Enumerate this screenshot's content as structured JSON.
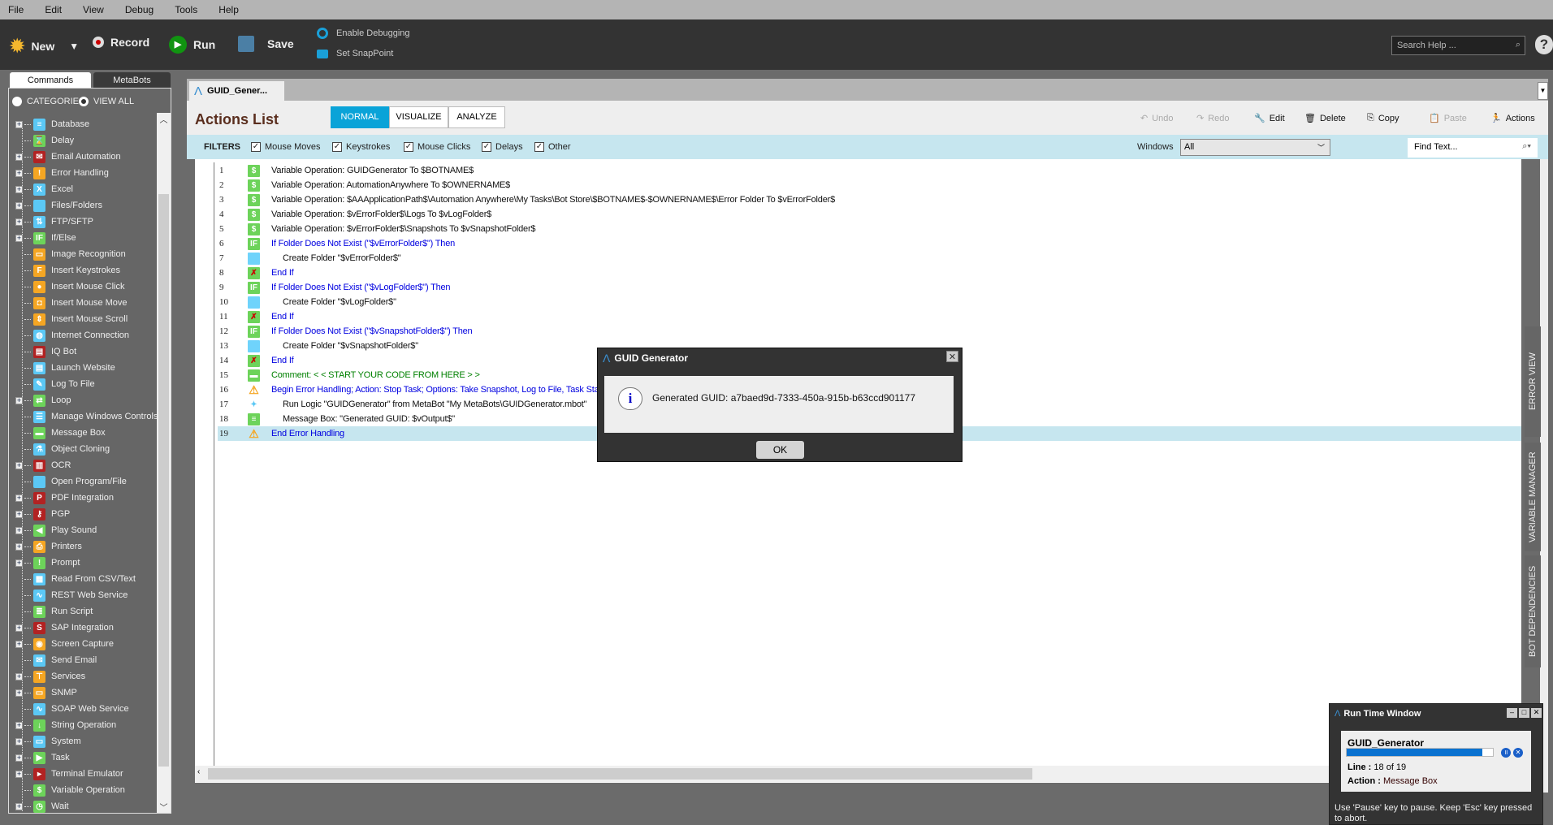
{
  "menu": [
    "File",
    "Edit",
    "View",
    "Debug",
    "Tools",
    "Help"
  ],
  "toolbar": {
    "new": "New",
    "record": "Record",
    "run": "Run",
    "save": "Save",
    "enable_debugging": "Enable Debugging",
    "set_snappoint": "Set SnapPoint",
    "search_placeholder": "Search Help ...",
    "help": "?"
  },
  "left": {
    "tabs": [
      "Commands",
      "MetaBots"
    ],
    "radios": [
      "CATEGORIES",
      "VIEW ALL"
    ],
    "categories": [
      {
        "label": "Database",
        "exp": true,
        "color": "#5bc8f5",
        "g": "≡"
      },
      {
        "label": "Delay",
        "exp": false,
        "color": "#6dd35a",
        "g": "⌛"
      },
      {
        "label": "Email Automation",
        "exp": true,
        "color": "#b22222",
        "g": "✉"
      },
      {
        "label": "Error Handling",
        "exp": true,
        "color": "#f5a623",
        "g": "!"
      },
      {
        "label": "Excel",
        "exp": true,
        "color": "#5bc8f5",
        "g": "X"
      },
      {
        "label": "Files/Folders",
        "exp": true,
        "color": "#5bc8f5",
        "g": ""
      },
      {
        "label": "FTP/SFTP",
        "exp": true,
        "color": "#5bc8f5",
        "g": "⇅"
      },
      {
        "label": "If/Else",
        "exp": true,
        "color": "#6dd35a",
        "g": "IF"
      },
      {
        "label": "Image Recognition",
        "exp": false,
        "color": "#f5a623",
        "g": "▭"
      },
      {
        "label": "Insert Keystrokes",
        "exp": false,
        "color": "#f5a623",
        "g": "F"
      },
      {
        "label": "Insert Mouse Click",
        "exp": false,
        "color": "#f5a623",
        "g": "●"
      },
      {
        "label": "Insert Mouse Move",
        "exp": false,
        "color": "#f5a623",
        "g": "◘"
      },
      {
        "label": "Insert Mouse Scroll",
        "exp": false,
        "color": "#f5a623",
        "g": "⇕"
      },
      {
        "label": "Internet Connection",
        "exp": false,
        "color": "#5bc8f5",
        "g": "◍"
      },
      {
        "label": "IQ Bot",
        "exp": false,
        "color": "#b22222",
        "g": "▤"
      },
      {
        "label": "Launch Website",
        "exp": false,
        "color": "#5bc8f5",
        "g": "▤"
      },
      {
        "label": "Log To File",
        "exp": false,
        "color": "#5bc8f5",
        "g": "✎"
      },
      {
        "label": "Loop",
        "exp": true,
        "color": "#6dd35a",
        "g": "⇄"
      },
      {
        "label": "Manage Windows Controls",
        "exp": false,
        "color": "#5bc8f5",
        "g": "☰"
      },
      {
        "label": "Message Box",
        "exp": false,
        "color": "#6dd35a",
        "g": "▬"
      },
      {
        "label": "Object Cloning",
        "exp": false,
        "color": "#5bc8f5",
        "g": "⚗"
      },
      {
        "label": "OCR",
        "exp": true,
        "color": "#b22222",
        "g": "▥"
      },
      {
        "label": "Open Program/File",
        "exp": false,
        "color": "#5bc8f5",
        "g": ""
      },
      {
        "label": "PDF Integration",
        "exp": true,
        "color": "#b22222",
        "g": "P"
      },
      {
        "label": "PGP",
        "exp": true,
        "color": "#b22222",
        "g": "⚷"
      },
      {
        "label": "Play Sound",
        "exp": true,
        "color": "#6dd35a",
        "g": "◀"
      },
      {
        "label": "Printers",
        "exp": true,
        "color": "#f5a623",
        "g": "⎙"
      },
      {
        "label": "Prompt",
        "exp": true,
        "color": "#6dd35a",
        "g": "!"
      },
      {
        "label": "Read From CSV/Text",
        "exp": false,
        "color": "#5bc8f5",
        "g": "▦"
      },
      {
        "label": "REST Web Service",
        "exp": false,
        "color": "#5bc8f5",
        "g": "∿"
      },
      {
        "label": "Run Script",
        "exp": false,
        "color": "#6dd35a",
        "g": "≣"
      },
      {
        "label": "SAP Integration",
        "exp": true,
        "color": "#b22222",
        "g": "S"
      },
      {
        "label": "Screen Capture",
        "exp": true,
        "color": "#f5a623",
        "g": "◉"
      },
      {
        "label": "Send Email",
        "exp": false,
        "color": "#5bc8f5",
        "g": "✉"
      },
      {
        "label": "Services",
        "exp": true,
        "color": "#f5a623",
        "g": "⊤"
      },
      {
        "label": "SNMP",
        "exp": true,
        "color": "#f5a623",
        "g": "▭"
      },
      {
        "label": "SOAP Web Service",
        "exp": false,
        "color": "#5bc8f5",
        "g": "∿"
      },
      {
        "label": "String Operation",
        "exp": true,
        "color": "#6dd35a",
        "g": "↓"
      },
      {
        "label": "System",
        "exp": true,
        "color": "#5bc8f5",
        "g": "▭"
      },
      {
        "label": "Task",
        "exp": true,
        "color": "#6dd35a",
        "g": "▶"
      },
      {
        "label": "Terminal Emulator",
        "exp": true,
        "color": "#b22222",
        "g": "▸"
      },
      {
        "label": "Variable Operation",
        "exp": false,
        "color": "#6dd35a",
        "g": "$"
      },
      {
        "label": "Wait",
        "exp": true,
        "color": "#6dd35a",
        "g": "◷"
      }
    ]
  },
  "tab": {
    "title": "GUID_Gener..."
  },
  "actions": {
    "title": "Actions List",
    "modes": [
      "NORMAL",
      "VISUALIZE",
      "ANALYZE"
    ],
    "active_mode": "NORMAL",
    "buttons": [
      {
        "label": "Undo",
        "g": "↶",
        "enabled": false
      },
      {
        "label": "Redo",
        "g": "↷",
        "enabled": false
      },
      {
        "label": "Edit",
        "g": "🔧",
        "enabled": true
      },
      {
        "label": "Delete",
        "g": "🗑",
        "enabled": true
      },
      {
        "label": "Copy",
        "g": "⎘",
        "enabled": true
      },
      {
        "label": "Paste",
        "g": "📋",
        "enabled": false
      },
      {
        "label": "Actions",
        "g": "🏃",
        "enabled": true
      }
    ]
  },
  "filters": {
    "label": "FILTERS",
    "items": [
      "Mouse Moves",
      "Keystrokes",
      "Mouse Clicks",
      "Delays",
      "Other"
    ],
    "windows_label": "Windows",
    "windows_value": "All",
    "find_placeholder": "Find Text..."
  },
  "lines": [
    {
      "n": "1",
      "t": "Variable Operation: GUIDGenerator To $BOTNAME$",
      "k": "var",
      "c": "#111",
      "i": 0
    },
    {
      "n": "2",
      "t": "Variable Operation: AutomationAnywhere To $OWNERNAME$",
      "k": "var",
      "c": "#111",
      "i": 0
    },
    {
      "n": "3",
      "t": "Variable Operation: $AAApplicationPath$\\Automation Anywhere\\My Tasks\\Bot Store\\$BOTNAME$-$OWNERNAME$\\Error Folder To $vErrorFolder$",
      "k": "var",
      "c": "#111",
      "i": 0
    },
    {
      "n": "4",
      "t": "Variable Operation: $vErrorFolder$\\Logs To $vLogFolder$",
      "k": "var",
      "c": "#111",
      "i": 0
    },
    {
      "n": "5",
      "t": "Variable Operation: $vErrorFolder$\\Snapshots To $vSnapshotFolder$",
      "k": "var",
      "c": "#111",
      "i": 0
    },
    {
      "n": "6",
      "t": "If Folder Does Not Exist (\"$vErrorFolder$\")  Then",
      "k": "if",
      "c": "#0000e0",
      "i": 0
    },
    {
      "n": "7",
      "t": "Create Folder \"$vErrorFolder$\"",
      "k": "folder",
      "c": "#111",
      "i": 1
    },
    {
      "n": "8",
      "t": "End If",
      "k": "endif",
      "c": "#0000e0",
      "i": 0
    },
    {
      "n": "9",
      "t": "If Folder Does Not Exist (\"$vLogFolder$\")  Then",
      "k": "if",
      "c": "#0000e0",
      "i": 0
    },
    {
      "n": "10",
      "t": "Create Folder \"$vLogFolder$\"",
      "k": "folder",
      "c": "#111",
      "i": 1
    },
    {
      "n": "11",
      "t": "End If",
      "k": "endif",
      "c": "#0000e0",
      "i": 0
    },
    {
      "n": "12",
      "t": "If Folder Does Not Exist (\"$vSnapshotFolder$\")  Then",
      "k": "if",
      "c": "#0000e0",
      "i": 0
    },
    {
      "n": "13",
      "t": "Create Folder \"$vSnapshotFolder$\"",
      "k": "folder",
      "c": "#111",
      "i": 1
    },
    {
      "n": "14",
      "t": "End If",
      "k": "endif",
      "c": "#0000e0",
      "i": 0
    },
    {
      "n": "15",
      "t": "Comment: < < START YOUR CODE FROM HERE > >",
      "k": "comment",
      "c": "#008000",
      "i": 0
    },
    {
      "n": "16",
      "t": "Begin Error Handling; Action: Stop Task; Options: Take Snapshot, Log to File,  Task Status",
      "k": "err",
      "c": "#0000e0",
      "i": 0
    },
    {
      "n": "17",
      "t": "Run Logic \"GUIDGenerator\" from MetaBot \"My MetaBots\\GUIDGenerator.mbot\"",
      "k": "metabot",
      "c": "#111",
      "i": 1
    },
    {
      "n": "18",
      "t": "Message Box: \"Generated GUID: $vOutput$\"",
      "k": "msg",
      "c": "#111",
      "i": 1
    },
    {
      "n": "19",
      "t": "End Error Handling",
      "k": "err",
      "c": "#0000e0",
      "i": 0,
      "selected": true
    }
  ],
  "side_tabs": [
    "ERROR VIEW",
    "VARIABLE MANAGER",
    "BOT DEPENDENCIES"
  ],
  "dialog": {
    "title": "GUID Generator",
    "message": "Generated GUID: a7baed9d-7333-450a-915b-b63ccd901177",
    "ok": "OK"
  },
  "runtime": {
    "title": "Run Time Window",
    "task": "GUID_Generator",
    "progress": 0.93,
    "line_label": "Line :",
    "line_value": "18 of 19",
    "action_label": "Action :",
    "action_value": "Message Box",
    "hint": "Use 'Pause' key to pause. Keep 'Esc' key pressed to abort."
  }
}
